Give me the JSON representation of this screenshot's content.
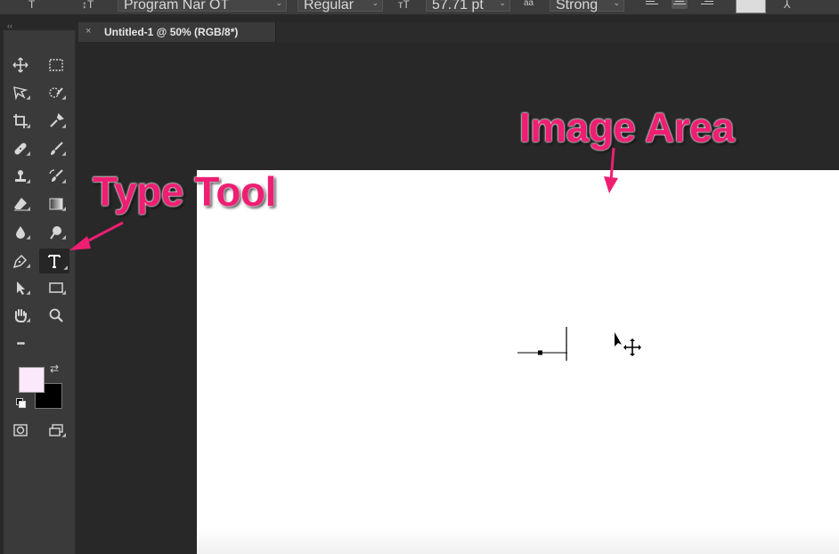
{
  "options_bar": {
    "font_family": "Program Nar OT",
    "font_style": "Regular",
    "font_size": "57.71 pt",
    "antialias": "Strong",
    "aa_label": "aa"
  },
  "document_tab": {
    "close_glyph": "×",
    "title": "Untitled-1 @ 50% (RGB/8*)"
  },
  "toolbar": {
    "collapse_glyph": "‹‹",
    "more_glyph": "•••",
    "tools": [
      {
        "name": "move-tool",
        "icon": "move-icon"
      },
      {
        "name": "marquee-tool",
        "icon": "rectangular-marquee-icon"
      },
      {
        "name": "lasso-tool",
        "icon": "polygonal-lasso-icon"
      },
      {
        "name": "quick-selection-tool",
        "icon": "quick-selection-icon"
      },
      {
        "name": "crop-tool",
        "icon": "crop-icon"
      },
      {
        "name": "eyedropper-tool",
        "icon": "eyedropper-icon"
      },
      {
        "name": "healing-brush-tool",
        "icon": "bandage-icon"
      },
      {
        "name": "brush-tool",
        "icon": "brush-icon"
      },
      {
        "name": "clone-stamp-tool",
        "icon": "stamp-icon"
      },
      {
        "name": "history-brush-tool",
        "icon": "history-brush-icon"
      },
      {
        "name": "eraser-tool",
        "icon": "eraser-icon"
      },
      {
        "name": "gradient-tool",
        "icon": "gradient-icon"
      },
      {
        "name": "blur-tool",
        "icon": "drop-icon"
      },
      {
        "name": "dodge-tool",
        "icon": "dodge-icon"
      },
      {
        "name": "pen-tool",
        "icon": "pen-icon"
      },
      {
        "name": "type-tool",
        "icon": "type-icon",
        "active": true
      },
      {
        "name": "path-selection-tool",
        "icon": "arrow-icon"
      },
      {
        "name": "rectangle-tool",
        "icon": "rectangle-icon"
      },
      {
        "name": "hand-tool",
        "icon": "hand-icon"
      },
      {
        "name": "zoom-tool",
        "icon": "zoom-icon"
      }
    ],
    "foreground_color": "#fbe8fb",
    "background_color": "#000000"
  },
  "annotations": {
    "type_tool_label": "Type Tool",
    "image_area_label": "Image Area",
    "color": "#ee1e72"
  }
}
